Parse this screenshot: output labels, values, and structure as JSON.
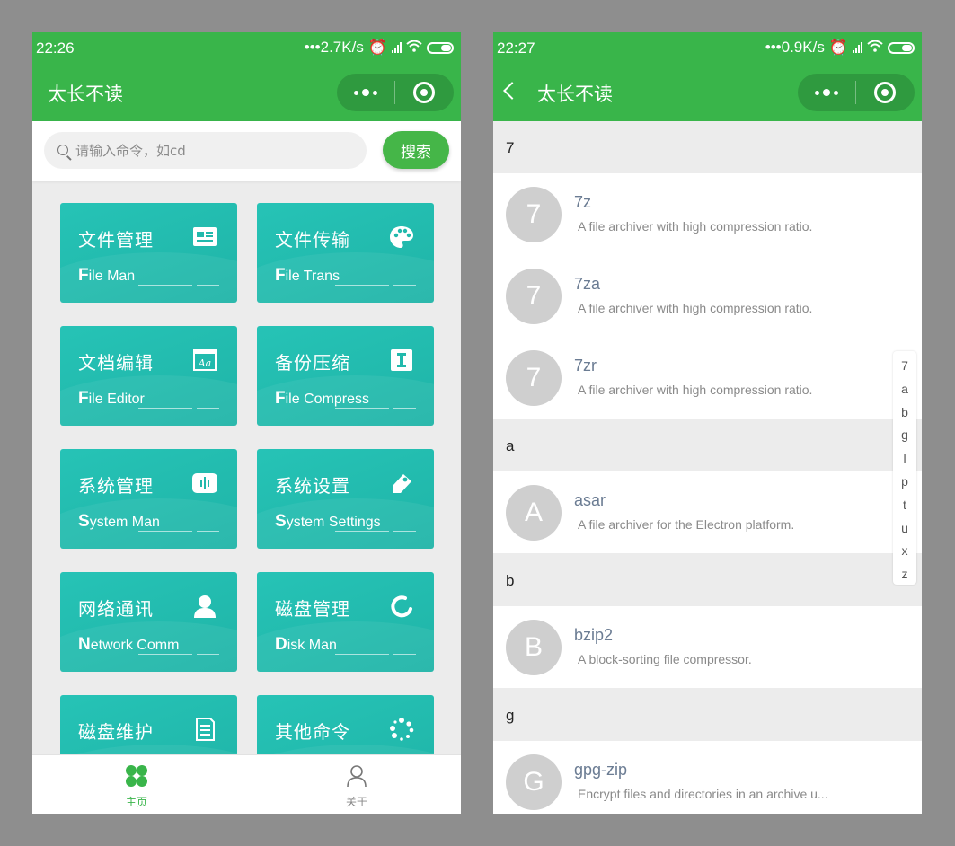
{
  "left": {
    "status": {
      "time": "22:26",
      "speed": "•••2.7K/s"
    },
    "nav": {
      "title": "太长不读"
    },
    "search": {
      "placeholder": "请输入命令，如cd",
      "button": "搜索"
    },
    "cards": [
      {
        "cn": "文件管理",
        "en_initial": "F",
        "en_rest": "ile Man",
        "icon": "id-card-icon"
      },
      {
        "cn": "文件传输",
        "en_initial": "F",
        "en_rest": "ile Trans",
        "icon": "palette-icon"
      },
      {
        "cn": "文档编辑",
        "en_initial": "F",
        "en_rest": "ile Editor",
        "icon": "font-icon"
      },
      {
        "cn": "备份压缩",
        "en_initial": "F",
        "en_rest": "ile Compress",
        "icon": "text-cursor-icon"
      },
      {
        "cn": "系统管理",
        "en_initial": "S",
        "en_rest": "ystem Man",
        "icon": "equalizer-icon"
      },
      {
        "cn": "系统设置",
        "en_initial": "S",
        "en_rest": "ystem Settings",
        "icon": "eraser-icon"
      },
      {
        "cn": "网络通讯",
        "en_initial": "N",
        "en_rest": "etwork Comm",
        "icon": "user-icon"
      },
      {
        "cn": "磁盘管理",
        "en_initial": "D",
        "en_rest": "isk Man",
        "icon": "circle-notch-icon"
      },
      {
        "cn": "磁盘维护",
        "en_initial": "",
        "en_rest": "",
        "icon": "document-icon"
      },
      {
        "cn": "其他命令",
        "en_initial": "",
        "en_rest": "",
        "icon": "spinner-icon"
      }
    ],
    "tabs": [
      {
        "label": "主页",
        "icon": "home-grid-icon",
        "active": true,
        "color": "#39b54a"
      },
      {
        "label": "关于",
        "icon": "person-icon",
        "active": false,
        "color": "#888888"
      }
    ]
  },
  "right": {
    "status": {
      "time": "22:27",
      "speed": "•••0.9K/s"
    },
    "nav": {
      "title": "太长不读"
    },
    "groups": [
      {
        "letter": "7",
        "items": [
          {
            "avatar": "7",
            "name": "7z",
            "desc": "A file archiver with high compression ratio."
          },
          {
            "avatar": "7",
            "name": "7za",
            "desc": "A file archiver with high compression ratio."
          },
          {
            "avatar": "7",
            "name": "7zr",
            "desc": "A file archiver with high compression ratio."
          }
        ]
      },
      {
        "letter": "a",
        "items": [
          {
            "avatar": "A",
            "name": "asar",
            "desc": "A file archiver for the Electron platform."
          }
        ]
      },
      {
        "letter": "b",
        "items": [
          {
            "avatar": "B",
            "name": "bzip2",
            "desc": "A block-sorting file compressor."
          }
        ]
      },
      {
        "letter": "g",
        "items": [
          {
            "avatar": "G",
            "name": "gpg-zip",
            "desc": "Encrypt files and directories in an archive u..."
          }
        ]
      }
    ],
    "index": [
      "7",
      "a",
      "b",
      "g",
      "l",
      "p",
      "t",
      "u",
      "x",
      "z"
    ]
  },
  "colors": {
    "brand_green": "#39b54a",
    "card_teal": "#21b9ac",
    "avatar_gray": "#cfcfcf"
  }
}
